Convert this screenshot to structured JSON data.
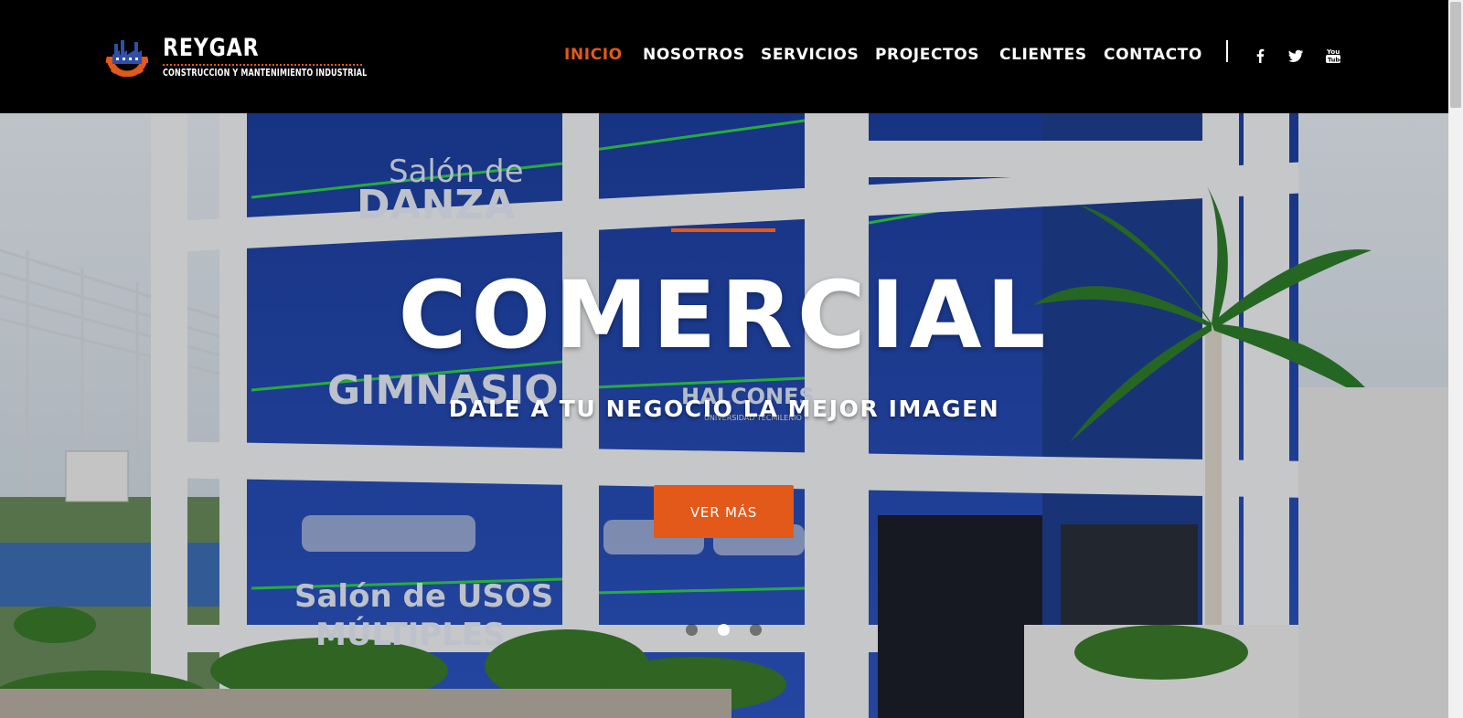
{
  "brand": {
    "name": "REYGAR",
    "tagline": "CONSTRUCCION Y MANTENIMIENTO INDUSTRIAL",
    "accent_color": "#e2591a"
  },
  "nav": {
    "items": [
      {
        "label": "INICIO",
        "active": true
      },
      {
        "label": "NOSOTROS",
        "active": false
      },
      {
        "label": "SERVICIOS",
        "active": false
      },
      {
        "label": "PROJECTOS",
        "active": false
      },
      {
        "label": "CLIENTES",
        "active": false
      },
      {
        "label": "CONTACTO",
        "active": false
      }
    ],
    "social": [
      "facebook-icon",
      "twitter-icon",
      "youtube-icon"
    ]
  },
  "hero": {
    "title": "COMERCIAL",
    "subtitle": "DALE A TU NEGOCIO LA MEJOR IMAGEN",
    "button_label": "VER MÁS",
    "photo_signs": {
      "sign_1_line_1": "Salón de",
      "sign_1_line_2": "DANZA",
      "sign_2": "GIMNASIO",
      "sign_3_line_1": "HALCONES",
      "sign_3_line_2": "UNIVERSIDAD TECMILENIO",
      "sign_4_line_1": "Salón de USOS",
      "sign_4_line_2": "MÚLTIPLES"
    },
    "slides": {
      "count": 3,
      "active_index": 1
    }
  }
}
